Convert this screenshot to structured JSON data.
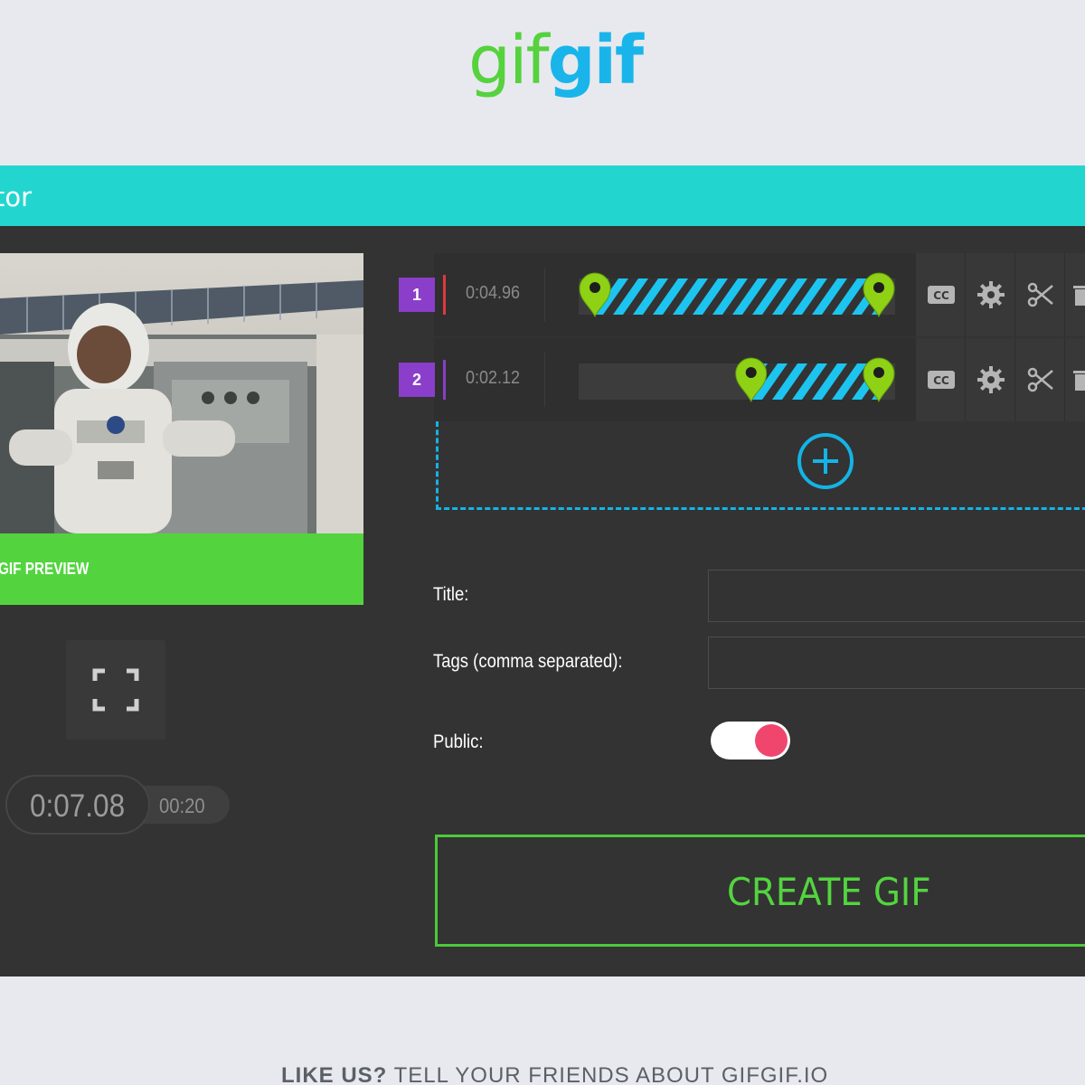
{
  "logo": {
    "part1": "gif",
    "part2": "gif"
  },
  "header": {
    "title_partial": "tor"
  },
  "preview": {
    "label": "GIF PREVIEW",
    "current_time": "0:07.08",
    "total_time": "00:20"
  },
  "segments": [
    {
      "index": "1",
      "duration": "0:04.96",
      "marker_color": "#e0393e",
      "range_start": 0.0,
      "range_end": 1.0
    },
    {
      "index": "2",
      "duration": "0:02.12",
      "marker_color": "#8a3ec9",
      "range_start": 0.55,
      "range_end": 1.0
    }
  ],
  "segment_tools": [
    "cc-icon",
    "gear-icon",
    "scissors-icon",
    "trash-icon"
  ],
  "form": {
    "title_label": "Title:",
    "title_value": "",
    "tags_label": "Tags (comma separated):",
    "tags_value": "",
    "public_label": "Public:",
    "public_on": true
  },
  "create_button": "CREATE GIF",
  "footer": {
    "bold": "LIKE US?",
    "rest": " TELL YOUR FRIENDS ABOUT GIFGIF.IO"
  },
  "colors": {
    "accent_teal": "#22d6cf",
    "accent_green": "#53d43f",
    "accent_blue": "#14b3e6",
    "toggle_knob": "#f0466e"
  }
}
